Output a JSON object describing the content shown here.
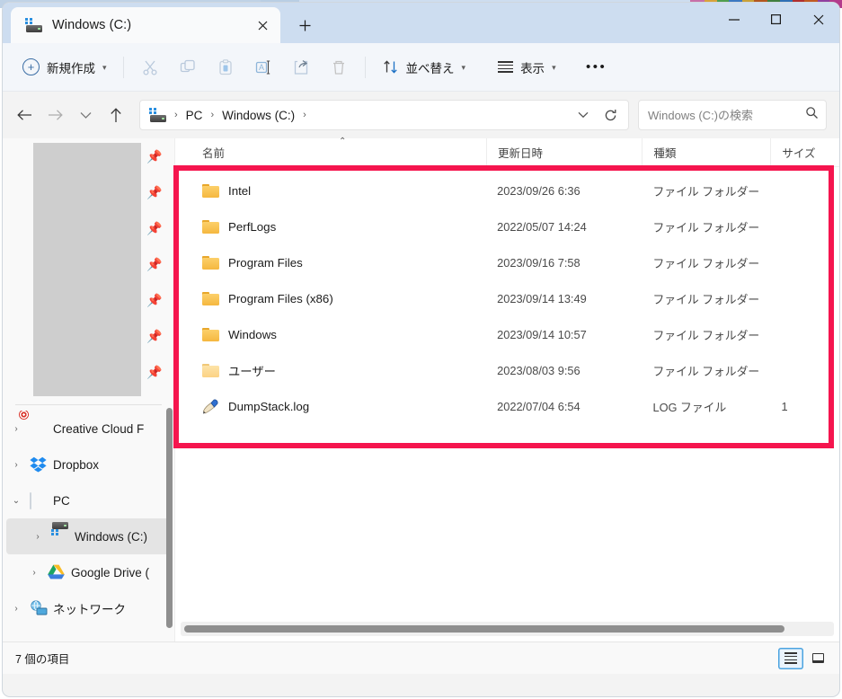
{
  "window": {
    "tab_title": "Windows (C:)",
    "tab_close_icon": "close-icon",
    "new_tab_icon": "plus-icon",
    "minimize_icon": "minimize-icon",
    "maximize_icon": "maximize-icon",
    "close_icon": "close-icon",
    "background_strip_colors": [
      "#9ab4d0",
      "#9ab4d0",
      "#c76fa8",
      "#d8a23c",
      "#4f9e4f",
      "#3b78c2",
      "#c9a13a",
      "#b3561f",
      "#3f7f3f",
      "#2f6fb5",
      "#b02f2f",
      "#c05a22",
      "#8f3fa0",
      "#b33b8c"
    ]
  },
  "ribbon": {
    "new_label": "新規作成",
    "new_icon": "plus-circle-icon",
    "new_chevron": "chevron-down-icon",
    "cut_icon": "scissors-icon",
    "copy_icon": "copy-icon",
    "paste_icon": "paste-icon",
    "rename_icon": "rename-icon",
    "share_icon": "share-icon",
    "delete_icon": "trash-icon",
    "sort_label": "並べ替え",
    "sort_icon": "sort-arrows-icon",
    "sort_chevron": "chevron-down-icon",
    "view_label": "表示",
    "view_icon": "list-lines-icon",
    "view_chevron": "chevron-down-icon",
    "more_icon": "ellipsis-icon"
  },
  "nav": {
    "back_icon": "arrow-left-icon",
    "forward_icon": "arrow-right-icon",
    "recent_icon": "chevron-down-icon",
    "up_icon": "arrow-up-icon",
    "breadcrumb_drive_icon": "drive-icon",
    "breadcrumbs": [
      "PC",
      "Windows (C:)"
    ],
    "separator": "›",
    "history_icon": "chevron-down-icon",
    "refresh_icon": "refresh-icon"
  },
  "search": {
    "placeholder": "Windows (C:)の検索",
    "value": "",
    "icon": "search-icon"
  },
  "sidebar": {
    "pin_icon": "pin-icon",
    "pin_count": 7,
    "redacted_block": true,
    "items": [
      {
        "label": "Creative Cloud F",
        "icon": "creative-cloud-icon",
        "arrow": "chevron-right-icon",
        "indent": false,
        "selected": false
      },
      {
        "label": "Dropbox",
        "icon": "dropbox-icon",
        "arrow": "chevron-right-icon",
        "indent": false,
        "selected": false
      },
      {
        "label": "PC",
        "icon": "pc-icon",
        "arrow": "chevron-down-icon",
        "indent": false,
        "selected": false
      },
      {
        "label": "Windows (C:)",
        "icon": "drive-icon",
        "arrow": "chevron-right-icon",
        "indent": true,
        "selected": true
      },
      {
        "label": "Google Drive (",
        "icon": "google-drive-icon",
        "arrow": "chevron-right-icon",
        "indent": true,
        "selected": false
      },
      {
        "label": "ネットワーク",
        "icon": "network-icon",
        "arrow": "chevron-right-icon",
        "indent": false,
        "selected": false
      }
    ]
  },
  "filelist": {
    "columns": [
      {
        "key": "name",
        "label": "名前",
        "sorted": "asc"
      },
      {
        "key": "date",
        "label": "更新日時",
        "sorted": ""
      },
      {
        "key": "type",
        "label": "種類",
        "sorted": ""
      },
      {
        "key": "size",
        "label": "サイズ",
        "sorted": ""
      }
    ],
    "sort_caret": "caret-up-icon",
    "rows": [
      {
        "name": "Intel",
        "date": "2023/09/26 6:36",
        "type": "ファイル フォルダー",
        "size": "",
        "icon": "folder-icon"
      },
      {
        "name": "PerfLogs",
        "date": "2022/05/07 14:24",
        "type": "ファイル フォルダー",
        "size": "",
        "icon": "folder-icon"
      },
      {
        "name": "Program Files",
        "date": "2023/09/16 7:58",
        "type": "ファイル フォルダー",
        "size": "",
        "icon": "folder-icon"
      },
      {
        "name": "Program Files (x86)",
        "date": "2023/09/14 13:49",
        "type": "ファイル フォルダー",
        "size": "",
        "icon": "folder-icon"
      },
      {
        "name": "Windows",
        "date": "2023/09/14 10:57",
        "type": "ファイル フォルダー",
        "size": "",
        "icon": "folder-icon"
      },
      {
        "name": "ユーザー",
        "date": "2023/08/03 9:56",
        "type": "ファイル フォルダー",
        "size": "",
        "icon": "folder-shortcut-icon"
      },
      {
        "name": "DumpStack.log",
        "date": "2022/07/04 6:54",
        "type": "LOG ファイル",
        "size": "1",
        "icon": "log-file-icon"
      }
    ]
  },
  "annotation": {
    "color": "#f5154e",
    "shape": "rectangle-highlight"
  },
  "statusbar": {
    "item_count_text": "7 個の項目",
    "details_view_icon": "details-view-icon",
    "large_icons_view_icon": "large-icons-view-icon",
    "active_view": "details"
  },
  "scrollbars": {
    "sidebar_vertical": true,
    "pane_horizontal": true
  }
}
